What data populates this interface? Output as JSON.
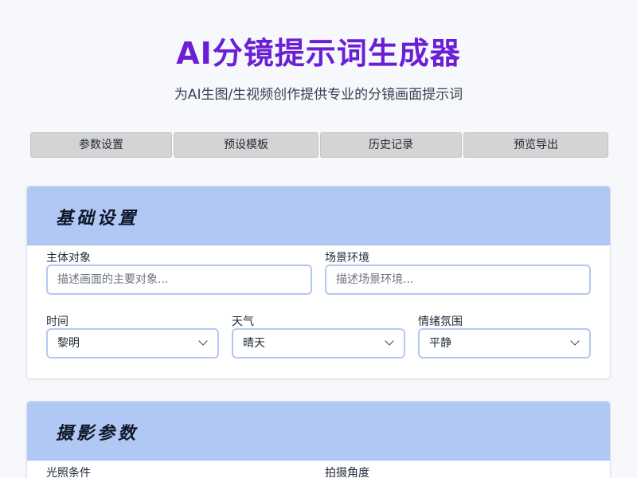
{
  "header": {
    "title": "AI分镜提示词生成器",
    "subtitle": "为AI生图/生视频创作提供专业的分镜画面提示词"
  },
  "tabs": [
    {
      "label": "参数设置"
    },
    {
      "label": "预设模板"
    },
    {
      "label": "历史记录"
    },
    {
      "label": "预览导出"
    }
  ],
  "basic": {
    "title": "基础设置",
    "subject": {
      "label": "主体对象",
      "placeholder": "描述画面的主要对象..."
    },
    "scene": {
      "label": "场景环境",
      "placeholder": "描述场景环境..."
    },
    "time": {
      "label": "时间",
      "value": "黎明"
    },
    "weather": {
      "label": "天气",
      "value": "晴天"
    },
    "mood": {
      "label": "情绪氛围",
      "value": "平静"
    }
  },
  "camera": {
    "title": "摄影参数",
    "lighting": {
      "label": "光照条件"
    },
    "angle": {
      "label": "拍摄角度"
    }
  }
}
